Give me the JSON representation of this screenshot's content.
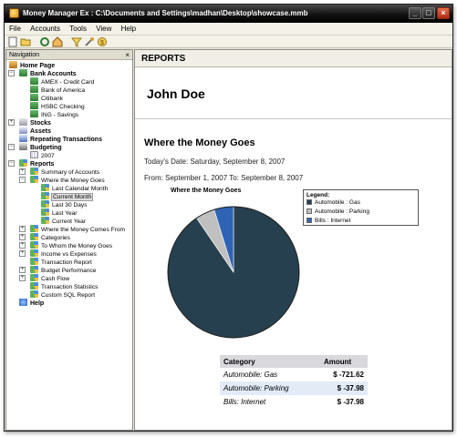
{
  "window": {
    "title": "Money Manager Ex : C:\\Documents and Settings\\madhan\\Desktop\\showcase.mmb",
    "minimize": "_",
    "maximize": "□",
    "close": "×"
  },
  "menu": [
    "File",
    "Accounts",
    "Tools",
    "View",
    "Help"
  ],
  "toolbar": [
    "new-file-icon",
    "open-folder-icon",
    "refresh-icon",
    "home-icon",
    "filter-icon",
    "tools-icon",
    "money-icon"
  ],
  "navigation": {
    "header": "Navigation",
    "close_symbol": "×",
    "home": "Home Page",
    "bank_accounts": "Bank Accounts",
    "accounts": [
      "AMEX - Credit Card",
      "Bank of America",
      "Citibank",
      "HSBC Checking",
      "ING - Savings"
    ],
    "stocks": "Stocks",
    "assets": "Assets",
    "repeating": "Repeating Transactions",
    "budgeting": "Budgeting",
    "budget_year": "2007",
    "reports": "Reports",
    "summary": "Summary of Accounts",
    "where_goes": "Where the Money Goes",
    "where_goes_children": [
      "Last Calendar Month",
      "Current Month",
      "Last 30 Days",
      "Last Year",
      "Current Year"
    ],
    "report_items": [
      "Where the Money Comes From",
      "Categories",
      "To Whom the Money Goes",
      "Income vs Expenses",
      "Transaction Report",
      "Budget Performance",
      "Cash Flow",
      "Transaction Statistics",
      "Custom SQL Report"
    ],
    "help": "Help"
  },
  "report": {
    "header": "REPORTS",
    "user": "John Doe",
    "title": "Where the Money Goes",
    "today": "Today's Date: Saturday, September 8, 2007",
    "range": "From: September 1, 2007 To: September 8, 2007",
    "table": {
      "headers": [
        "Category",
        "Amount"
      ],
      "rows": [
        {
          "category": "Automobile: Gas",
          "amount": "$ -721.62"
        },
        {
          "category": "Automobile: Parking",
          "amount": "$ -37.98"
        },
        {
          "category": "Bills: Internet",
          "amount": "$ -37.98"
        }
      ]
    }
  },
  "chart_data": {
    "type": "pie",
    "title": "Where the Money Goes",
    "legend_title": "Legend:",
    "legend_position": "top-right",
    "series": [
      {
        "name": "Automobile : Gas",
        "value": 721.62,
        "color": "#27404f"
      },
      {
        "name": "Automobile : Parking",
        "value": 37.98,
        "color": "#c0c0c0"
      },
      {
        "name": "Bills : Internet",
        "value": 37.98,
        "color": "#2f63b4"
      }
    ]
  }
}
